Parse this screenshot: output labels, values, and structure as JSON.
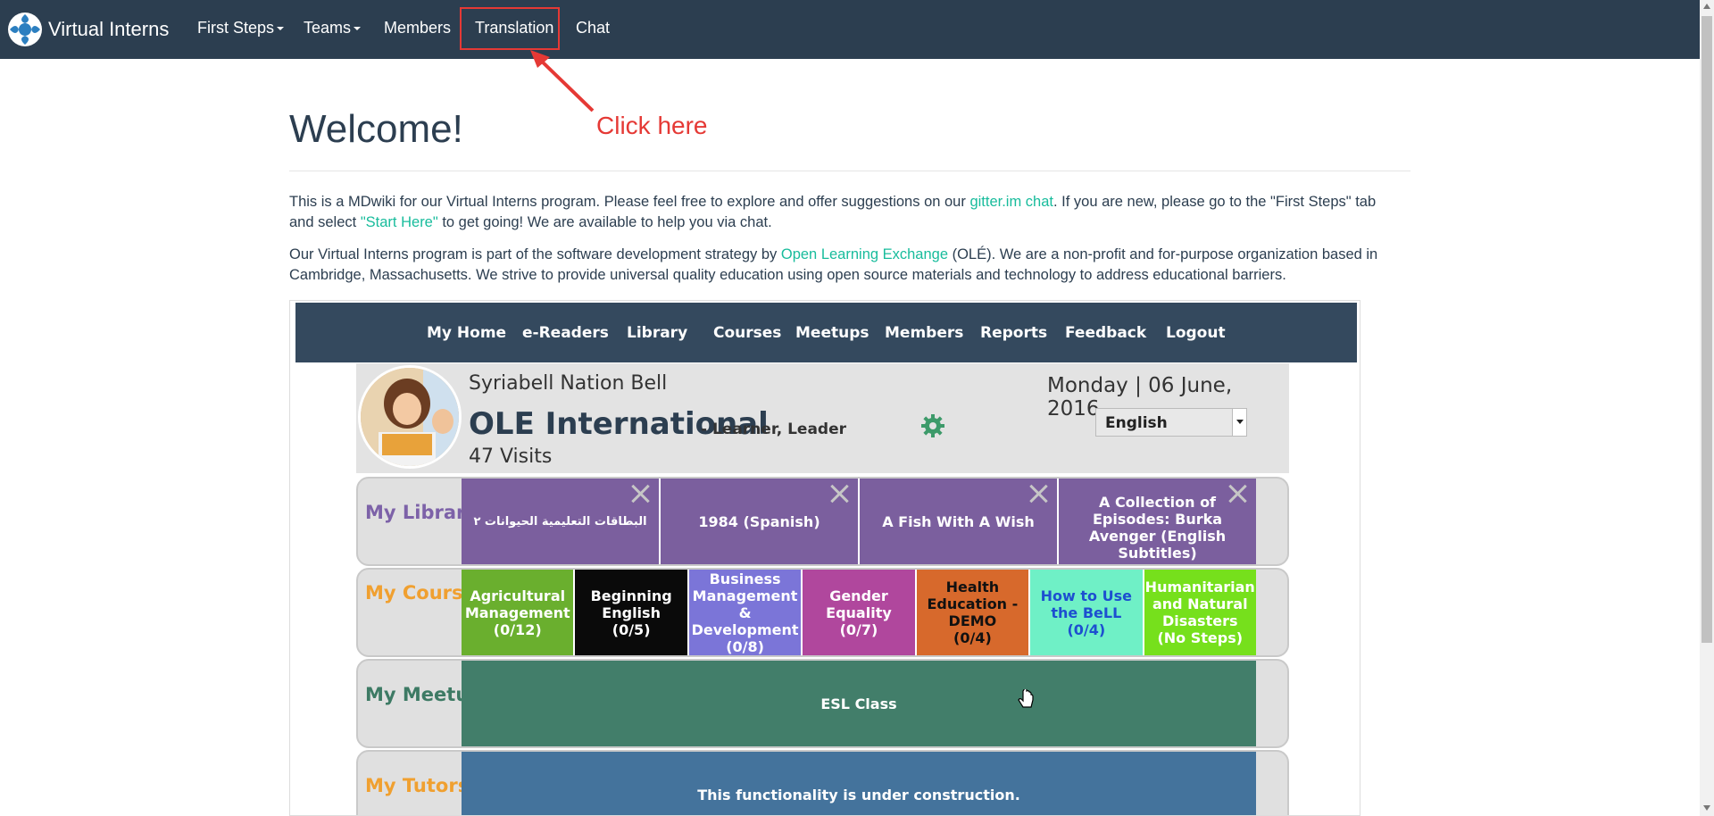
{
  "brand": {
    "name": "Virtual Interns",
    "logo_icon": "virtual-interns-logo-icon"
  },
  "nav": {
    "items": [
      {
        "label": "First Steps",
        "dropdown": true
      },
      {
        "label": "Teams",
        "dropdown": true
      },
      {
        "label": "Members",
        "dropdown": false
      },
      {
        "label": "Translation",
        "dropdown": false,
        "highlighted": true
      },
      {
        "label": "Chat",
        "dropdown": false
      }
    ]
  },
  "annotation": {
    "text": "Click here",
    "color": "#e53935"
  },
  "page": {
    "title": "Welcome!",
    "p1": {
      "t1": "This is a MDwiki for our Virtual Interns program. Please feel free to explore and offer suggestions on our ",
      "link1": "gitter.im chat",
      "t2": ". If you are new, please go to the \"First Steps\" tab and select ",
      "link2": "\"Start Here\"",
      "t3": " to get going! We are available to help you via chat."
    },
    "p2": {
      "t1": "Our Virtual Interns program is part of the software development strategy by ",
      "link1": "Open Learning Exchange",
      "t2": " (OLÉ). We are a non-profit and for-purpose organization based in Cambridge, Massachusetts. We strive to provide universal quality education using open source materials and technology to address educational barriers."
    }
  },
  "bell": {
    "nav": [
      "My Home",
      "e-Readers",
      "Library",
      "Courses",
      "Meetups",
      "Members",
      "Reports",
      "Feedback",
      "Logout"
    ],
    "site_name": "Syriabell Nation Bell",
    "org_name": "OLE International",
    "role": "- Learner, Leader",
    "visits": "47 Visits",
    "date": "Monday | 06 June, 2016",
    "language": "English",
    "library": {
      "label": "My Library",
      "items": [
        "البطاقات التعليمية الحيوانات ٢",
        "1984 (Spanish)",
        "A Fish With A Wish",
        "A Collection of Episodes: Burka Avenger (English Subtitles)"
      ]
    },
    "courses": {
      "label": "My Courses Progress",
      "items": [
        {
          "title": "Agricultural Management",
          "progress": "(0/12)",
          "color": "#6aaf2e",
          "text": "#ffffff"
        },
        {
          "title": "Beginning English",
          "progress": "(0/5)",
          "color": "#0a0a0a",
          "text": "#ffffff"
        },
        {
          "title": "Business Management & Development",
          "progress": "(0/8)",
          "color": "#7b75d8",
          "text": "#ffffff"
        },
        {
          "title": "Gender Equality",
          "progress": "(0/7)",
          "color": "#b0479d",
          "text": "#ffffff"
        },
        {
          "title": "Health Education - DEMO",
          "progress": "(0/4)",
          "color": "#d7692c",
          "text": "#111111"
        },
        {
          "title": "How to Use the BeLL",
          "progress": "(0/4)",
          "color": "#6ff0c6",
          "text": "#1d4fd0"
        },
        {
          "title": "Humanitarian and Natural Disasters",
          "progress": "(No Steps)",
          "color": "#76e01c",
          "text": "#ffffff"
        }
      ]
    },
    "meetups": {
      "label": "My Meetups",
      "item": "ESL Class"
    },
    "tutors": {
      "label": "My Tutors",
      "item": "This functionality is under construction."
    },
    "colors": {
      "library_label": "#7d62a8",
      "courses_label": "#f0a030",
      "meetups_label": "#3d7a64",
      "library_tile": "#7b5f9e",
      "meetups_tile": "#427e6a",
      "tutors_tile": "#44739c"
    }
  }
}
